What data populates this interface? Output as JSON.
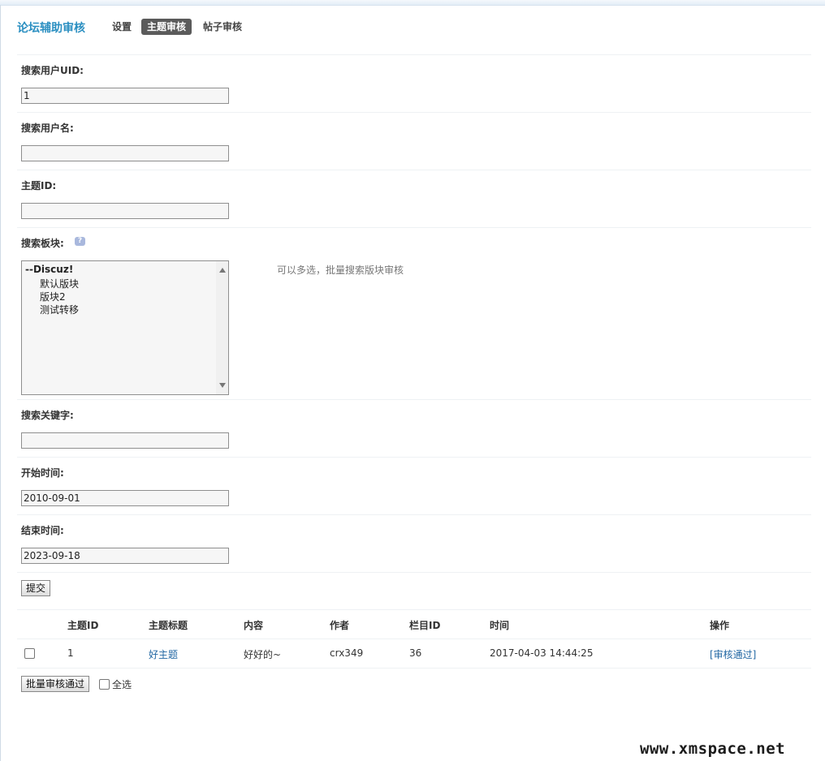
{
  "header": {
    "title": "论坛辅助审核",
    "tabs": [
      {
        "label": "设置"
      },
      {
        "label": "主题审核",
        "active": true
      },
      {
        "label": "帖子审核"
      }
    ]
  },
  "form": {
    "uid_label": "搜索用户UID:",
    "uid_value": "1",
    "username_label": "搜索用户名:",
    "username_value": "",
    "thread_id_label": "主题ID:",
    "thread_id_value": "",
    "forum_label": "搜索板块:",
    "forum_help_icon": "?",
    "forum_options": [
      {
        "label": "--Discuz!",
        "group": true
      },
      {
        "label": "默认版块"
      },
      {
        "label": "版块2"
      },
      {
        "label": "测试转移"
      }
    ],
    "forum_hint": "可以多选，批量搜索版块审核",
    "keyword_label": "搜索关键字:",
    "keyword_value": "",
    "start_label": "开始时间:",
    "start_value": "2010-09-01",
    "end_label": "结束时间:",
    "end_value": "2023-09-18",
    "submit_label": "提交"
  },
  "table": {
    "headers": [
      "主题ID",
      "主题标题",
      "内容",
      "作者",
      "栏目ID",
      "时间",
      "操作"
    ],
    "rows": [
      {
        "id": "1",
        "title": "好主题",
        "content": "好好的~",
        "author": "crx349",
        "column_id": "36",
        "time": "2017-04-03 14:44:25",
        "action": "[审核通过]"
      }
    ]
  },
  "footer": {
    "batch_label": "批量审核通过",
    "select_all_label": "全选"
  },
  "watermark": "www.xmspace.net",
  "colors": {
    "accent": "#2b8fc1",
    "link": "#2267a3",
    "active_tab_bg": "#5b5b5b"
  }
}
